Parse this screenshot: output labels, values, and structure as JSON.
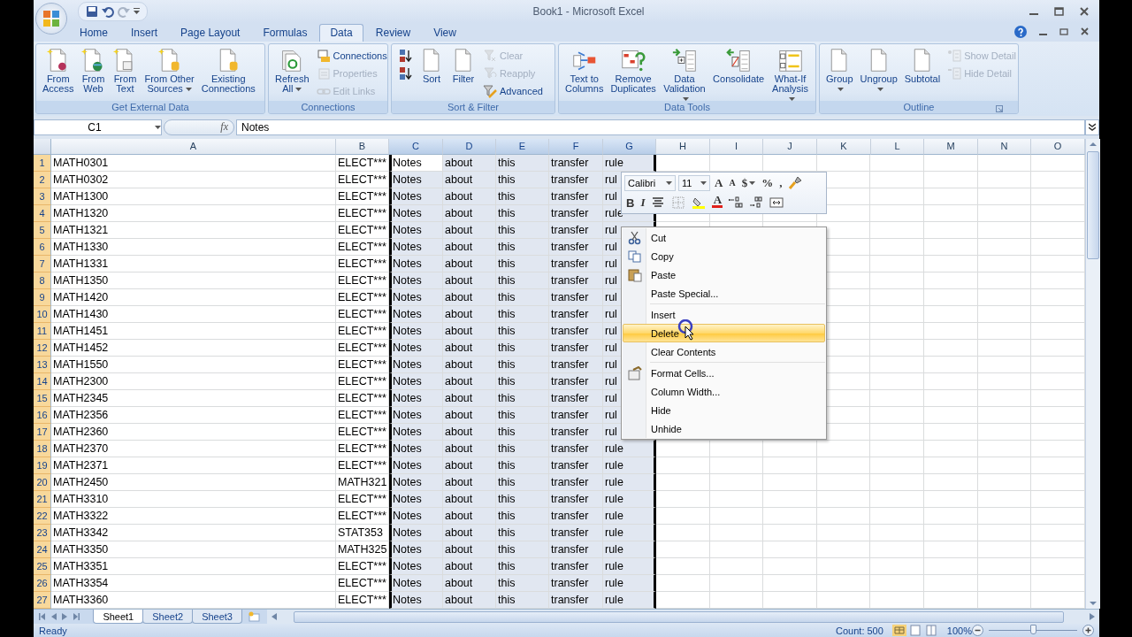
{
  "window": {
    "title": "Book1 - Microsoft Excel"
  },
  "tabs": [
    {
      "label": "Home",
      "selected": false
    },
    {
      "label": "Insert",
      "selected": false
    },
    {
      "label": "Page Layout",
      "selected": false
    },
    {
      "label": "Formulas",
      "selected": false
    },
    {
      "label": "Data",
      "selected": true
    },
    {
      "label": "Review",
      "selected": false
    },
    {
      "label": "View",
      "selected": false
    }
  ],
  "ribbon": [
    {
      "label": "Get External Data",
      "buttons": [
        {
          "kind": "large",
          "label": "From\nAccess",
          "disabled": false,
          "dropdown": false
        },
        {
          "kind": "large",
          "label": "From\nWeb",
          "disabled": false,
          "dropdown": false
        },
        {
          "kind": "large",
          "label": "From\nText",
          "disabled": false,
          "dropdown": false
        },
        {
          "kind": "large",
          "label": "From Other\nSources",
          "disabled": false,
          "dropdown": true
        },
        {
          "kind": "large",
          "label": "Existing\nConnections",
          "disabled": false,
          "dropdown": false
        }
      ]
    },
    {
      "label": "Connections",
      "buttons": [
        {
          "kind": "large",
          "label": "Refresh\nAll",
          "disabled": false,
          "dropdown": true
        },
        {
          "kind": "small",
          "label": "Connections",
          "disabled": false,
          "dropdown": false
        },
        {
          "kind": "small",
          "label": "Properties",
          "disabled": true,
          "dropdown": false
        },
        {
          "kind": "small",
          "label": "Edit Links",
          "disabled": true,
          "dropdown": false
        }
      ]
    },
    {
      "label": "Sort & Filter",
      "buttons": [
        {
          "kind": "icon",
          "disabled": false
        },
        {
          "kind": "icon",
          "disabled": false
        },
        {
          "kind": "large",
          "label": "Sort",
          "disabled": false,
          "dropdown": false
        },
        {
          "kind": "large",
          "label": "Filter",
          "disabled": false,
          "dropdown": false
        },
        {
          "kind": "small",
          "label": "Clear",
          "disabled": true,
          "dropdown": false
        },
        {
          "kind": "small",
          "label": "Reapply",
          "disabled": true,
          "dropdown": false
        },
        {
          "kind": "small",
          "label": "Advanced",
          "disabled": false,
          "dropdown": false
        }
      ]
    },
    {
      "label": "Data Tools",
      "buttons": [
        {
          "kind": "large",
          "label": "Text to\nColumns",
          "disabled": false,
          "dropdown": false
        },
        {
          "kind": "large",
          "label": "Remove\nDuplicates",
          "disabled": false,
          "dropdown": false
        },
        {
          "kind": "large",
          "label": "Data\nValidation",
          "disabled": false,
          "dropdown": true
        },
        {
          "kind": "large",
          "label": "Consolidate",
          "disabled": false,
          "dropdown": false
        },
        {
          "kind": "large",
          "label": "What-If\nAnalysis",
          "disabled": false,
          "dropdown": true
        }
      ]
    },
    {
      "label": "Outline",
      "buttons": [
        {
          "kind": "large",
          "label": "Group",
          "disabled": false,
          "dropdown": true
        },
        {
          "kind": "large",
          "label": "Ungroup",
          "disabled": false,
          "dropdown": true
        },
        {
          "kind": "large",
          "label": "Subtotal",
          "disabled": false,
          "dropdown": false
        },
        {
          "kind": "small",
          "label": "Show Detail",
          "disabled": true,
          "dropdown": false
        },
        {
          "kind": "small",
          "label": "Hide Detail",
          "disabled": true,
          "dropdown": false
        }
      ]
    }
  ],
  "formula_bar": {
    "name_box": "C1",
    "function_label": "fx",
    "value": "Notes"
  },
  "columns": [
    {
      "label": "A",
      "selected": false
    },
    {
      "label": "B",
      "selected": false
    },
    {
      "label": "C",
      "selected": true
    },
    {
      "label": "D",
      "selected": true
    },
    {
      "label": "E",
      "selected": true
    },
    {
      "label": "F",
      "selected": true
    },
    {
      "label": "G",
      "selected": true
    },
    {
      "label": "H",
      "selected": false
    },
    {
      "label": "I",
      "selected": false
    },
    {
      "label": "J",
      "selected": false
    },
    {
      "label": "K",
      "selected": false
    },
    {
      "label": "L",
      "selected": false
    },
    {
      "label": "M",
      "selected": false
    },
    {
      "label": "N",
      "selected": false
    },
    {
      "label": "O",
      "selected": false
    }
  ],
  "rows": [
    {
      "header": "1",
      "cells": [
        "MATH0301",
        "ELECT***",
        "Notes",
        "about",
        "this",
        "transfer",
        "rule"
      ]
    },
    {
      "header": "2",
      "cells": [
        "MATH0302",
        "ELECT***",
        "Notes",
        "about",
        "this",
        "transfer",
        "rul"
      ]
    },
    {
      "header": "3",
      "cells": [
        "MATH1300",
        "ELECT***",
        "Notes",
        "about",
        "this",
        "transfer",
        "rul"
      ]
    },
    {
      "header": "4",
      "cells": [
        "MATH1320",
        "ELECT***",
        "Notes",
        "about",
        "this",
        "transfer",
        "rule"
      ]
    },
    {
      "header": "5",
      "cells": [
        "MATH1321",
        "ELECT***",
        "Notes",
        "about",
        "this",
        "transfer",
        "rul"
      ]
    },
    {
      "header": "6",
      "cells": [
        "MATH1330",
        "ELECT***",
        "Notes",
        "about",
        "this",
        "transfer",
        "rul"
      ]
    },
    {
      "header": "7",
      "cells": [
        "MATH1331",
        "ELECT***",
        "Notes",
        "about",
        "this",
        "transfer",
        "rul"
      ]
    },
    {
      "header": "8",
      "cells": [
        "MATH1350",
        "ELECT***",
        "Notes",
        "about",
        "this",
        "transfer",
        "rul"
      ]
    },
    {
      "header": "9",
      "cells": [
        "MATH1420",
        "ELECT***",
        "Notes",
        "about",
        "this",
        "transfer",
        "rul"
      ]
    },
    {
      "header": "10",
      "cells": [
        "MATH1430",
        "ELECT***",
        "Notes",
        "about",
        "this",
        "transfer",
        "rul"
      ]
    },
    {
      "header": "11",
      "cells": [
        "MATH1451",
        "ELECT***",
        "Notes",
        "about",
        "this",
        "transfer",
        "rul"
      ]
    },
    {
      "header": "12",
      "cells": [
        "MATH1452",
        "ELECT***",
        "Notes",
        "about",
        "this",
        "transfer",
        "rul"
      ]
    },
    {
      "header": "13",
      "cells": [
        "MATH1550",
        "ELECT***",
        "Notes",
        "about",
        "this",
        "transfer",
        "rul"
      ]
    },
    {
      "header": "14",
      "cells": [
        "MATH2300",
        "ELECT***",
        "Notes",
        "about",
        "this",
        "transfer",
        "rul"
      ]
    },
    {
      "header": "15",
      "cells": [
        "MATH2345",
        "ELECT***",
        "Notes",
        "about",
        "this",
        "transfer",
        "rul"
      ]
    },
    {
      "header": "16",
      "cells": [
        "MATH2356",
        "ELECT***",
        "Notes",
        "about",
        "this",
        "transfer",
        "rul"
      ]
    },
    {
      "header": "17",
      "cells": [
        "MATH2360",
        "ELECT***",
        "Notes",
        "about",
        "this",
        "transfer",
        "rul"
      ]
    },
    {
      "header": "18",
      "cells": [
        "MATH2370",
        "ELECT***",
        "Notes",
        "about",
        "this",
        "transfer",
        "rule"
      ]
    },
    {
      "header": "19",
      "cells": [
        "MATH2371",
        "ELECT***",
        "Notes",
        "about",
        "this",
        "transfer",
        "rule"
      ]
    },
    {
      "header": "20",
      "cells": [
        "MATH2450",
        "MATH321",
        "Notes",
        "about",
        "this",
        "transfer",
        "rule"
      ]
    },
    {
      "header": "21",
      "cells": [
        "MATH3310",
        "ELECT***",
        "Notes",
        "about",
        "this",
        "transfer",
        "rule"
      ]
    },
    {
      "header": "22",
      "cells": [
        "MATH3322",
        "ELECT***",
        "Notes",
        "about",
        "this",
        "transfer",
        "rule"
      ]
    },
    {
      "header": "23",
      "cells": [
        "MATH3342",
        "STAT353",
        "Notes",
        "about",
        "this",
        "transfer",
        "rule"
      ]
    },
    {
      "header": "24",
      "cells": [
        "MATH3350",
        "MATH325",
        "Notes",
        "about",
        "this",
        "transfer",
        "rule"
      ]
    },
    {
      "header": "25",
      "cells": [
        "MATH3351",
        "ELECT***",
        "Notes",
        "about",
        "this",
        "transfer",
        "rule"
      ]
    },
    {
      "header": "26",
      "cells": [
        "MATH3354",
        "ELECT***",
        "Notes",
        "about",
        "this",
        "transfer",
        "rule"
      ]
    },
    {
      "header": "27",
      "cells": [
        "MATH3360",
        "ELECT***",
        "Notes",
        "about",
        "this",
        "transfer",
        "rule"
      ]
    }
  ],
  "mini_toolbar": {
    "font": "Calibri",
    "size": "11",
    "row_1": [
      {
        "kind": "grow",
        "label": "A"
      },
      {
        "kind": "shrink",
        "label": "A"
      },
      {
        "kind": "char",
        "label": "$",
        "dropdown": true
      },
      {
        "kind": "char",
        "label": "%",
        "dropdown": false
      },
      {
        "kind": "char",
        "label": ",",
        "dropdown": false
      },
      {
        "kind": "painter"
      }
    ],
    "row_2": [
      {
        "kind": "bold",
        "label": "B"
      },
      {
        "kind": "italic",
        "label": "I"
      },
      {
        "kind": "center"
      },
      {
        "kind": "borders"
      },
      {
        "kind": "fill"
      },
      {
        "kind": "fontcolor",
        "label": "A"
      },
      {
        "kind": "incdec"
      },
      {
        "kind": "decdec"
      },
      {
        "kind": "merge"
      }
    ]
  },
  "context_menu": {
    "sections": [
      [
        {
          "label": "Cut",
          "icon": true,
          "selected": false
        },
        {
          "label": "Copy",
          "icon": true,
          "selected": false
        },
        {
          "label": "Paste",
          "icon": true,
          "selected": false
        },
        {
          "label": "Paste Special...",
          "icon": false,
          "selected": false
        }
      ],
      [
        {
          "label": "Insert",
          "icon": false,
          "selected": false
        },
        {
          "label": "Delete",
          "icon": false,
          "selected": true
        },
        {
          "label": "Clear Contents",
          "icon": false,
          "selected": false
        }
      ],
      [
        {
          "label": "Format Cells...",
          "icon": true,
          "selected": false
        },
        {
          "label": "Column Width...",
          "icon": false,
          "selected": false
        },
        {
          "label": "Hide",
          "icon": false,
          "selected": false
        },
        {
          "label": "Unhide",
          "icon": false,
          "selected": false
        }
      ]
    ]
  },
  "sheet_tabs": [
    {
      "label": "Sheet1",
      "selected": true
    },
    {
      "label": "Sheet2",
      "selected": false
    },
    {
      "label": "Sheet3",
      "selected": false
    }
  ],
  "status_bar": {
    "mode": "Ready",
    "count": "Count: 500",
    "zoom": "100%",
    "zoom_slider": {
      "level": 0.5
    }
  }
}
